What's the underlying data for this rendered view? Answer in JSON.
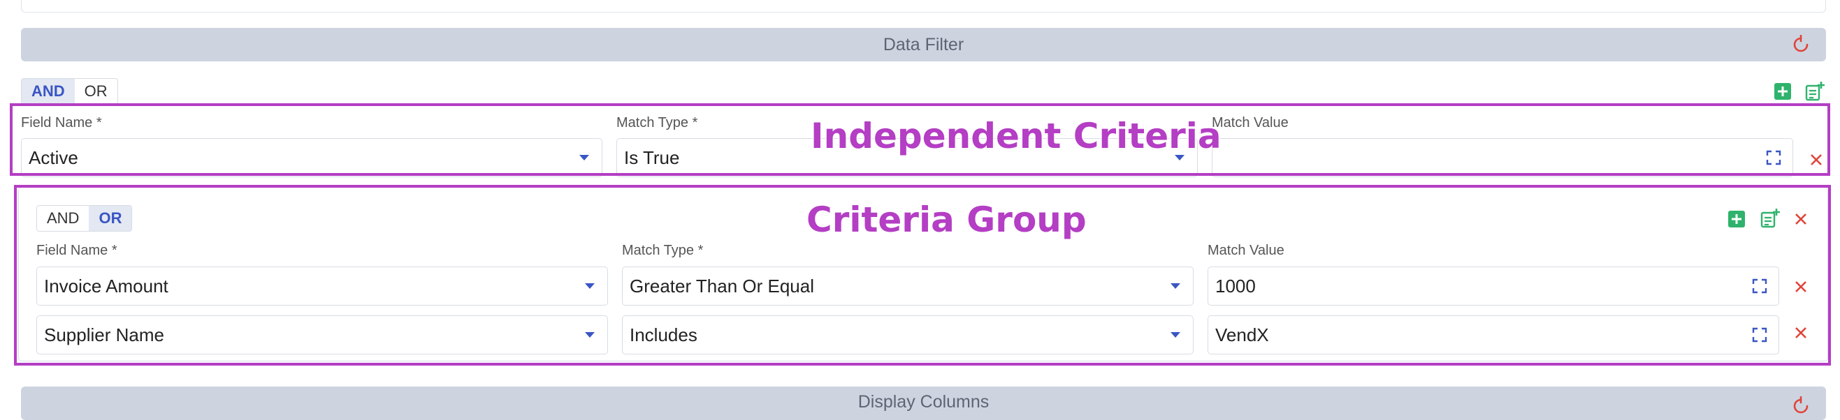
{
  "data_filter": {
    "title": "Data Filter",
    "reset_icon": "refresh-icon"
  },
  "display_columns": {
    "title": "Display Columns",
    "reset_icon": "refresh-icon"
  },
  "top_toggle": {
    "and_label": "AND",
    "or_label": "OR",
    "selected": "AND"
  },
  "labels": {
    "field_name": "Field Name *",
    "match_type": "Match Type *",
    "match_value": "Match Value"
  },
  "independent_row": {
    "field_name": "Active",
    "match_type": "Is True",
    "match_value": ""
  },
  "group": {
    "and_label": "AND",
    "or_label": "OR",
    "selected": "OR",
    "rows": [
      {
        "field_name": "Invoice Amount",
        "match_type": "Greater Than Or Equal",
        "match_value": "1000"
      },
      {
        "field_name": "Supplier Name",
        "match_type": "Includes",
        "match_value": "VendX"
      }
    ]
  },
  "annotations": {
    "independent": "Independent Criteria",
    "group": "Criteria Group"
  },
  "colors": {
    "accent": "#3a56c4",
    "remove": "#e0443a",
    "add": "#2fb36c",
    "annotation": "#b43ec4",
    "section_bar": "#cdd4e0"
  }
}
